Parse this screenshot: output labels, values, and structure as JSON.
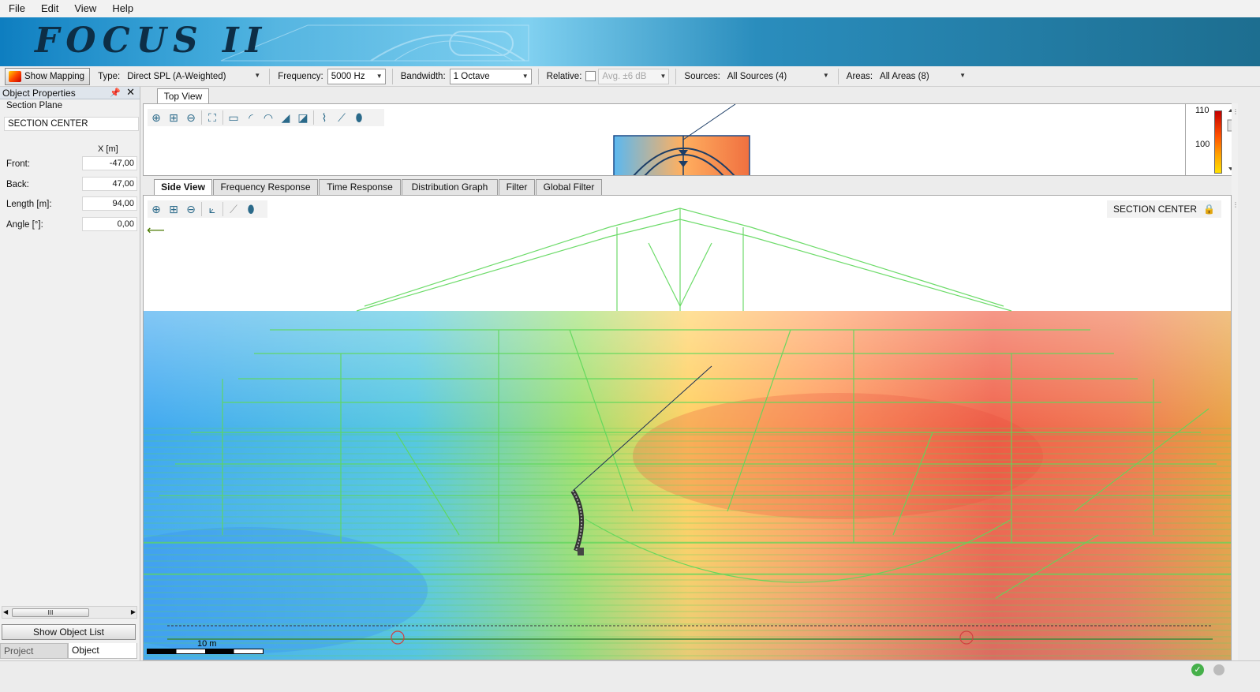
{
  "menu": [
    "File",
    "Edit",
    "View",
    "Help"
  ],
  "app": {
    "logo_text": "FOCUS II"
  },
  "toolbar": {
    "show_mapping": "Show Mapping",
    "type_label": "Type:",
    "type_value": "Direct SPL (A-Weighted)",
    "frequency_label": "Frequency:",
    "frequency_value": "5000 Hz",
    "bandwidth_label": "Bandwidth:",
    "bandwidth_value": "1 Octave",
    "relative_label": "Relative:",
    "avg_value": "Avg. ±6 dB",
    "sources_label": "Sources:",
    "sources_value": "All Sources (4)",
    "areas_label": "Areas:",
    "areas_value": "All Areas (8)"
  },
  "left_panel": {
    "title": "Object Properties",
    "section_label": "Section Plane",
    "object_name": "SECTION CENTER",
    "column_header": "X [m]",
    "rows": [
      {
        "label": "Front:",
        "value": "-47,00"
      },
      {
        "label": "Back:",
        "value": "47,00"
      },
      {
        "label": "Length [m]:",
        "value": "94,00"
      },
      {
        "label": "Angle [°]:",
        "value": "0,00"
      }
    ],
    "scroll_thumb": "III",
    "show_object_list": "Show Object List",
    "tabs": [
      "Project Prop...",
      "Object Prope..."
    ]
  },
  "top_view": {
    "tab": "Top View",
    "colorbar_max": "110",
    "colorbar_mid": "100"
  },
  "side_tabs": [
    "Side View",
    "Frequency Response",
    "Time Response",
    "Distribution Graph",
    "Filter",
    "Global Filter"
  ],
  "side_view": {
    "section_label": "SECTION CENTER",
    "scale_label": "10 m"
  },
  "colors": {
    "accent": "#1d7ab0",
    "wireframe": "#5ed85a",
    "heat_hot": "#f06050",
    "heat_cold": "#4aa8f0"
  }
}
